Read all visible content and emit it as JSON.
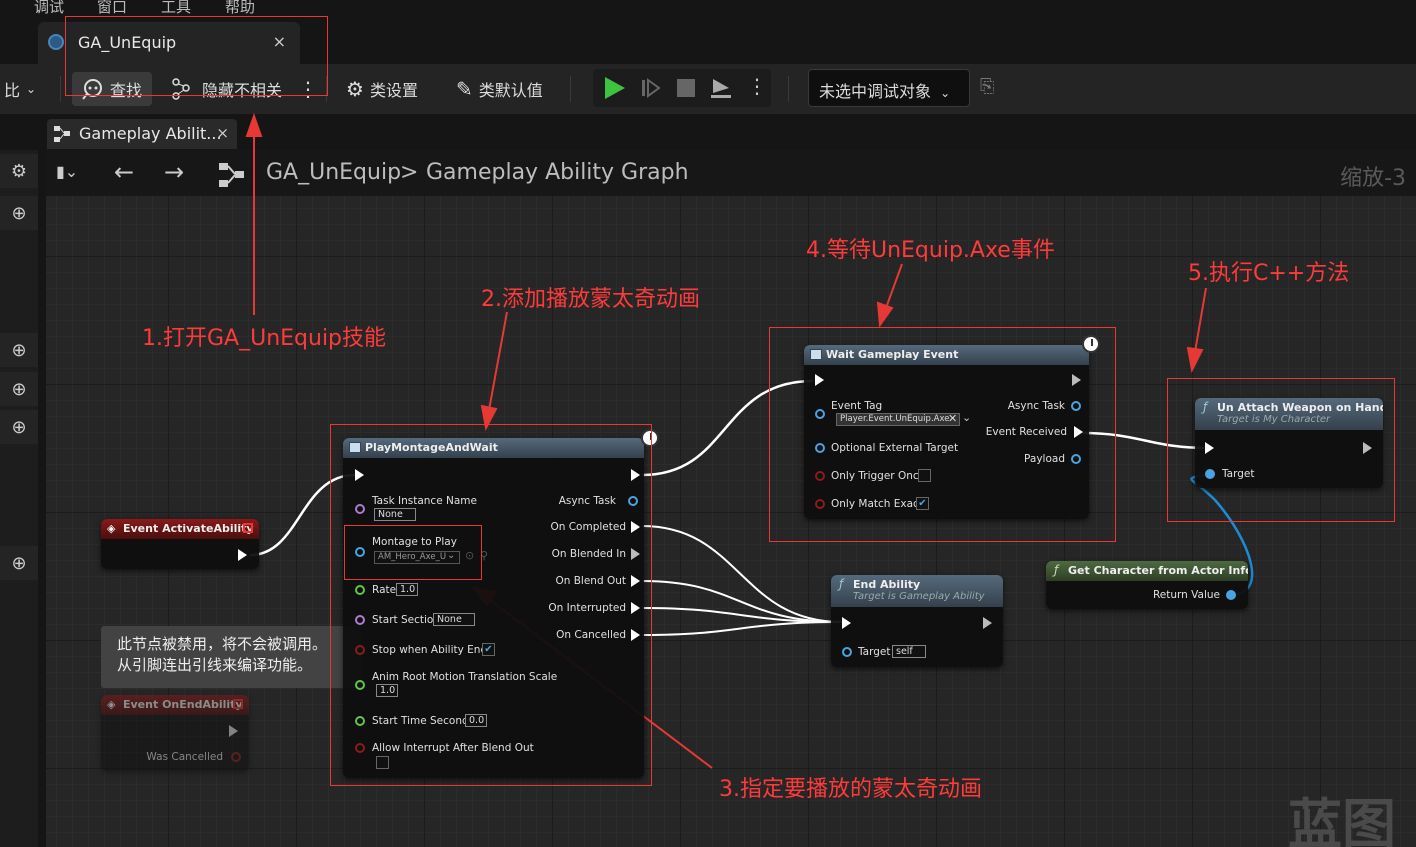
{
  "menu": [
    "调试",
    "窗口",
    "工具",
    "帮助"
  ],
  "document_tab": {
    "title": "GA_UnEquip",
    "close": "×"
  },
  "toolbar": {
    "compare": "比",
    "find": "查找",
    "hide_unrelated": "隐藏不相关",
    "class_settings": "类设置",
    "class_defaults": "类默认值",
    "debug_object": "未选中调试对象"
  },
  "graph_tab": {
    "title": "Gameplay Abilit...",
    "close": "×"
  },
  "breadcrumb": {
    "asset": "GA_UnEquip",
    "separator": ">",
    "graph": "Gameplay Ability Graph",
    "zoom": "缩放-3"
  },
  "nodes": {
    "activate": {
      "title": "Event ActivateAbility"
    },
    "onend": {
      "title": "Event OnEndAbility",
      "was_cancelled": "Was Cancelled"
    },
    "montage": {
      "title": "PlayMontageAndWait",
      "task_instance_name": "Task Instance Name",
      "task_instance_value": "None",
      "montage_to_play": "Montage to Play",
      "montage_value": "AM_Hero_Axe_U",
      "rate": "Rate",
      "rate_value": "1.0",
      "start_section": "Start Section",
      "start_section_value": "None",
      "stop_when_ends": "Stop when Ability Ends",
      "anim_root_motion": "Anim Root Motion Translation Scale",
      "anim_root_value": "1.0",
      "start_time": "Start Time Seconds",
      "start_time_value": "0.0",
      "allow_interrupt": "Allow Interrupt After Blend Out",
      "async_task": "Async Task",
      "on_completed": "On Completed",
      "on_blended_in": "On Blended In",
      "on_blend_out": "On Blend Out",
      "on_interrupted": "On Interrupted",
      "on_cancelled": "On Cancelled"
    },
    "wait": {
      "title": "Wait Gameplay Event",
      "event_tag": "Event Tag",
      "event_tag_value": "Player.Event.UnEquip.Axe",
      "optional_external_target": "Optional External Target",
      "only_trigger_once": "Only Trigger Once",
      "only_match_exact": "Only Match Exact",
      "async_task": "Async Task",
      "event_received": "Event Received",
      "payload": "Payload"
    },
    "end_ability": {
      "title": "End Ability",
      "subtitle": "Target is Gameplay Ability",
      "target": "Target",
      "target_value": "self"
    },
    "unattach": {
      "title": "Un Attach Weapon on Hand",
      "subtitle": "Target is My Character",
      "target": "Target"
    },
    "get_char": {
      "title": "Get Character from Actor Info",
      "return_value": "Return Value"
    }
  },
  "tooltip": {
    "line1": "此节点被禁用，将不会被调用。",
    "line2": "从引脚连出引线来编译功能。"
  },
  "annotations": {
    "a1": "1.打开GA_UnEquip技能",
    "a2": "2.添加播放蒙太奇动画",
    "a3": "3.指定要播放的蒙太奇动画",
    "a4": "4.等待UnEquip.Axe事件",
    "a5": "5.执行C++方法"
  },
  "watermark": "蓝图",
  "colors": {
    "annotation": "#e53935",
    "pin_object": "#4aa3e0",
    "pin_name": "#b07ad0",
    "pin_float": "#62c44a",
    "pin_bool": "#8a1c1c"
  }
}
